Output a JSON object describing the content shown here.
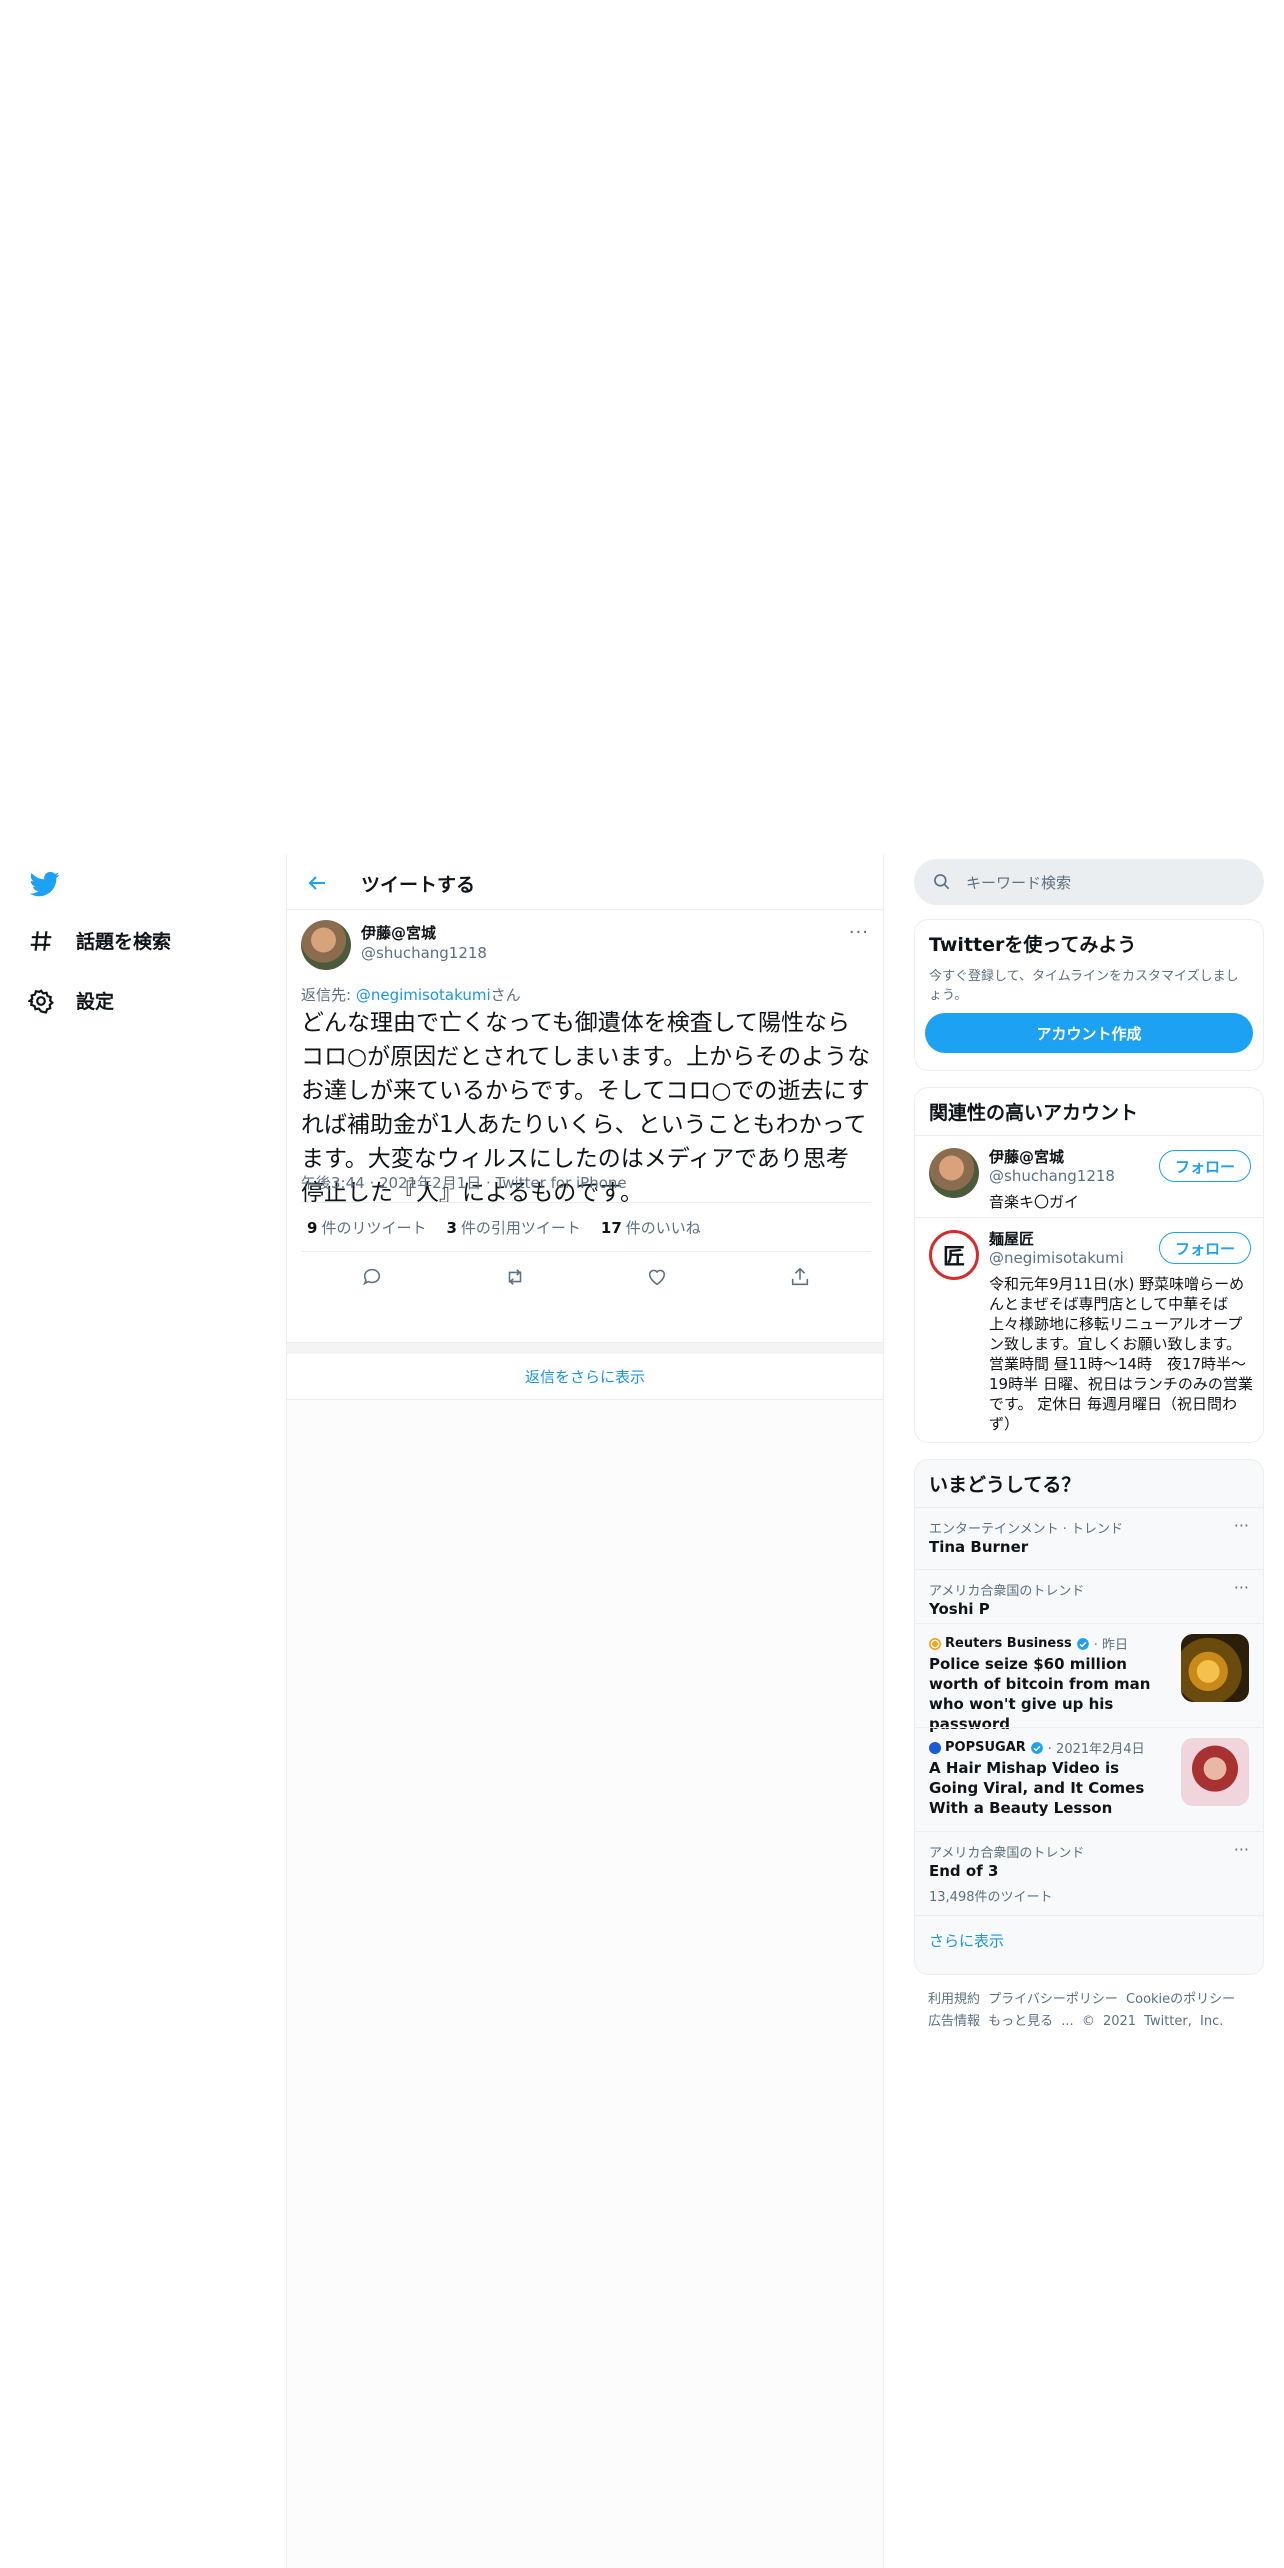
{
  "nav": {
    "explore_label": "話題を検索",
    "settings_label": "設定"
  },
  "header": {
    "title": "ツイートする"
  },
  "tweet": {
    "author_name": "伊藤@宮城",
    "author_handle": "@shuchang1218",
    "more": "···",
    "reply_prefix": "返信先: ",
    "reply_handle": "@negimisotakumi",
    "reply_suffix": "さん",
    "text": "どんな理由で亡くなっても御遺体を検査して陽性ならコロ○が原因だとされてしまいます。上からそのようなお達しが来ているからです。そしてコロ○での逝去にすれば補助金が1人あたりいくら、ということもわかってます。大変なウィルスにしたのはメディアであり思考停止した『人』によるものです。",
    "time": "午後3:44",
    "date": "2021年2月1日",
    "source": "Twitter for iPhone",
    "retweet_count": "9",
    "retweet_label": "件のリツイート",
    "quote_count": "3",
    "quote_label": "件の引用ツイート",
    "like_count": "17",
    "like_label": "件のいいね",
    "show_more_replies": "返信をさらに表示"
  },
  "search": {
    "placeholder": "キーワード検索"
  },
  "signup": {
    "title": "Twitterを使ってみよう",
    "desc": "今すぐ登録して、タイムラインをカスタマイズしましょう。",
    "button": "アカウント作成"
  },
  "related": {
    "title": "関連性の高いアカウント",
    "follow_label": "フォロー",
    "accounts": [
      {
        "name": "伊藤@宮城",
        "handle": "@shuchang1218",
        "bio": "音楽キ〇ガイ"
      },
      {
        "name": "麺屋匠",
        "handle": "@negimisotakumi",
        "bio": "令和元年9月11日(水) 野菜味噌らーめんとまぜそば専門店として中華そば上々様跡地に移転リニューアルオープン致します。宜しくお願い致します。営業時間 昼11時〜14時　夜17時半〜19時半 日曜、祝日はランチのみの営業です。 定休日 毎週月曜日（祝日問わず）",
        "avatar_char": "匠"
      }
    ]
  },
  "trends": {
    "title": "いまどうしてる？",
    "items": [
      {
        "category": "エンターテインメント · トレンド",
        "title": "Tina Burner"
      },
      {
        "category": "アメリカ合衆国のトレンド",
        "title": "Yoshi P"
      },
      {
        "source": "Reuters Business",
        "time": "· 昨日",
        "headline": "Police seize $60 million worth of bitcoin from man who won't give up his password"
      },
      {
        "source": "POPSUGAR",
        "time": "· 2021年2月4日",
        "headline": "A Hair Mishap Video is Going Viral, and It Comes With a Beauty Lesson"
      },
      {
        "category": "アメリカ合衆国のトレンド",
        "title": "End of 3",
        "count": "13,498件のツイート"
      }
    ],
    "show_more": "さらに表示"
  },
  "footer": {
    "links": [
      "利用規約",
      "プライバシーポリシー",
      "Cookieのポリシー",
      "広告情報",
      "もっと見る ..."
    ],
    "copyright": "© 2021 Twitter, Inc."
  },
  "colors": {
    "accent": "#1da1f2",
    "link": "#1b95e0",
    "muted": "#5b7083"
  }
}
